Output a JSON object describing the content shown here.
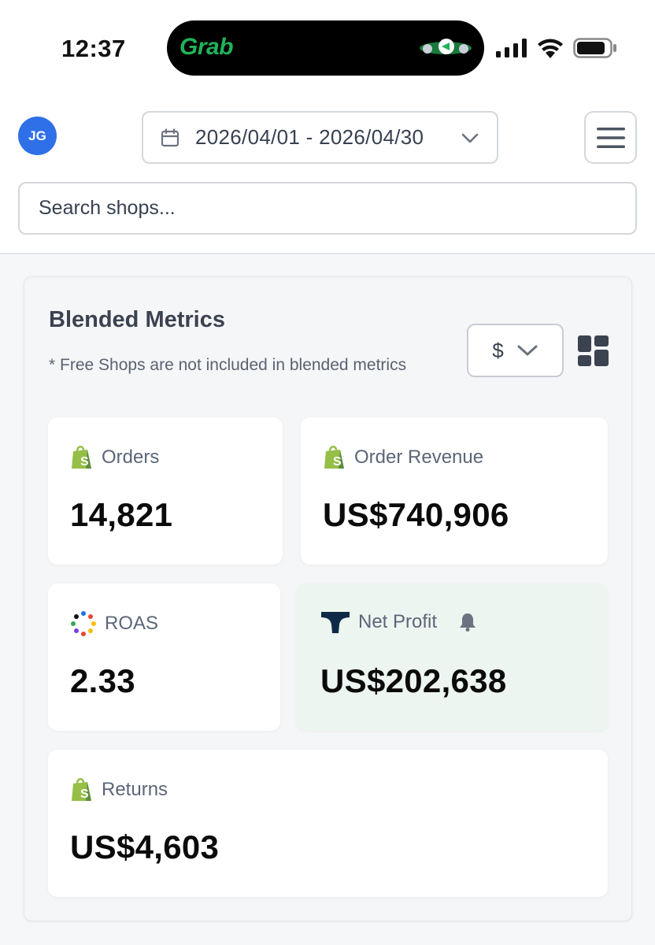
{
  "status_bar": {
    "time": "12:37",
    "island_app": "Grab"
  },
  "header": {
    "avatar_initials": "JG",
    "date_range": "2026/04/01 - 2026/04/30",
    "search_placeholder": "Search shops..."
  },
  "panel": {
    "title": "Blended Metrics",
    "note": "* Free Shops are not included in blended metrics",
    "currency_selected": "$"
  },
  "cards": {
    "orders": {
      "label": "Orders",
      "value": "14,821",
      "icon": "shopify-icon"
    },
    "order_revenue": {
      "label": "Order Revenue",
      "value": "US$740,906",
      "icon": "shopify-icon"
    },
    "roas": {
      "label": "ROAS",
      "value": "2.33",
      "icon": "dots-ring-icon"
    },
    "net_profit": {
      "label": "Net Profit",
      "value": "US$202,638",
      "icon": "brand-logo-icon",
      "extra_icon": "bell-icon"
    },
    "returns": {
      "label": "Returns",
      "value": "US$4,603",
      "icon": "shopify-icon"
    }
  },
  "colors": {
    "avatar": "#2f6fe8",
    "shopify_green": "#95bf47",
    "net_profit_bg": "#edf5f0",
    "brand_navy": "#0e2a47"
  }
}
